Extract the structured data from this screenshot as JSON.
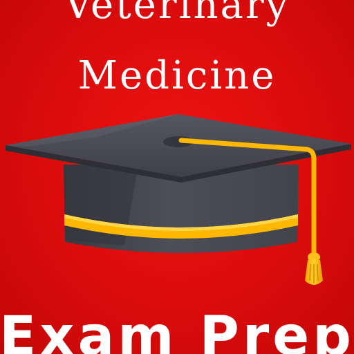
{
  "title": {
    "line1": "Veterinary",
    "line2": "Medicine"
  },
  "subtitle": "Exam Prep",
  "icon": "graduation-cap-icon",
  "colors": {
    "background": "#de0d0d",
    "text": "#ffffff",
    "cap": "#4b4c55",
    "cap_dark": "#34353c",
    "accent": "#ffc21a"
  }
}
